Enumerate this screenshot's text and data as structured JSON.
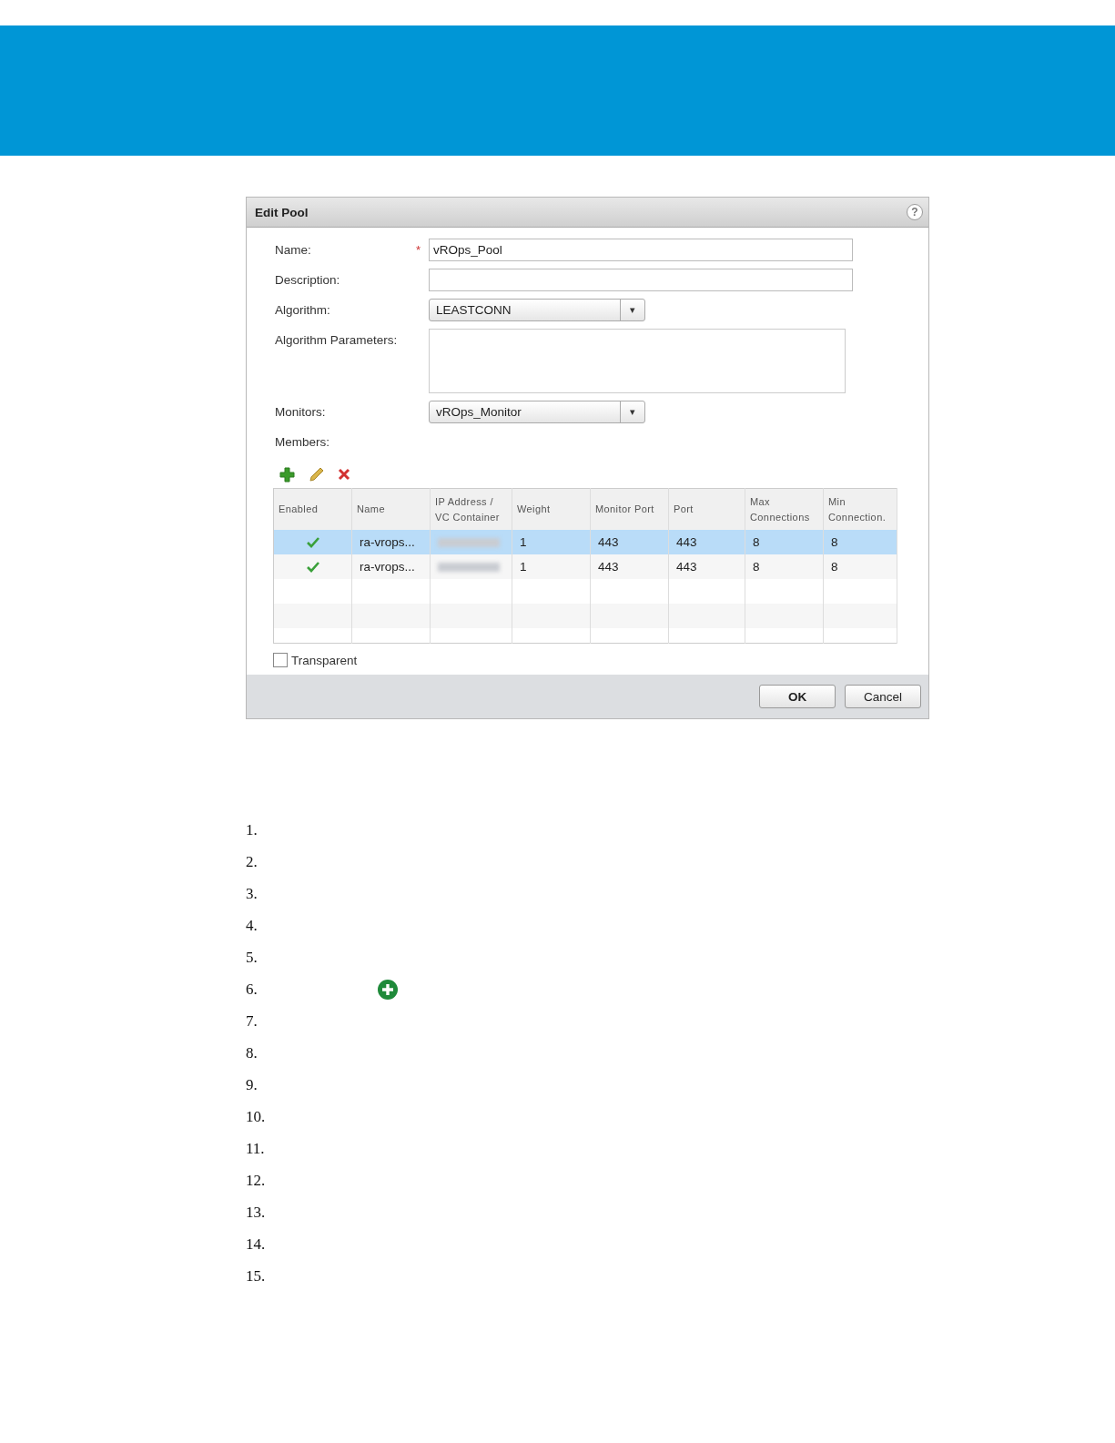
{
  "dialog": {
    "title": "Edit Pool",
    "help": "?",
    "fields": [
      {
        "kind": "text",
        "label": "Name:",
        "required_marker": "*",
        "value": "vROps_Pool"
      },
      {
        "kind": "text",
        "label": "Description:"
      },
      {
        "kind": "dropdown",
        "label": "Algorithm:",
        "value": "LEASTCONN",
        "caret": "▾"
      },
      {
        "kind": "textarea",
        "label": "Algorithm Parameters:"
      },
      {
        "kind": "dropdown",
        "label": "Monitors:",
        "value": "vROps_Monitor",
        "caret": "▾"
      }
    ],
    "members_label": "Members:",
    "table": {
      "columns": [
        "Enabled",
        "Name",
        "IP Address / VC Container",
        "Weight",
        "Monitor Port",
        "Port",
        "Max Connections",
        "Min Connection."
      ],
      "rows": [
        {
          "selected": true,
          "enabled": true,
          "name": "ra-vrops...",
          "weight": "1",
          "monitor_port": "443",
          "port": "443",
          "max_connections": "8",
          "min_connections": "8"
        },
        {
          "selected": false,
          "enabled": true,
          "name": "ra-vrops...",
          "weight": "1",
          "monitor_port": "443",
          "port": "443",
          "max_connections": "8",
          "min_connections": "8"
        }
      ]
    },
    "transparent": {
      "label": "Transparent",
      "checked": false
    },
    "buttons": [
      "OK",
      "Cancel"
    ]
  },
  "steps": [
    {
      "number": "1.",
      "kind": "plain"
    },
    {
      "number": "2.",
      "kind": "plain"
    },
    {
      "number": "3.",
      "kind": "plain"
    },
    {
      "number": "4.",
      "kind": "plain"
    },
    {
      "number": "5.",
      "kind": "plain"
    },
    {
      "number": "6.",
      "kind": "add_icon"
    },
    {
      "number": "7.",
      "kind": "plain"
    },
    {
      "number": "8.",
      "kind": "plain"
    },
    {
      "number": "9.",
      "kind": "plain"
    },
    {
      "number": "10.",
      "kind": "plain"
    },
    {
      "number": "11.",
      "kind": "plain"
    },
    {
      "number": "12.",
      "kind": "plain"
    },
    {
      "number": "13.",
      "kind": "plain"
    },
    {
      "number": "14.",
      "kind": "plain"
    },
    {
      "number": "15.",
      "kind": "plain"
    }
  ]
}
